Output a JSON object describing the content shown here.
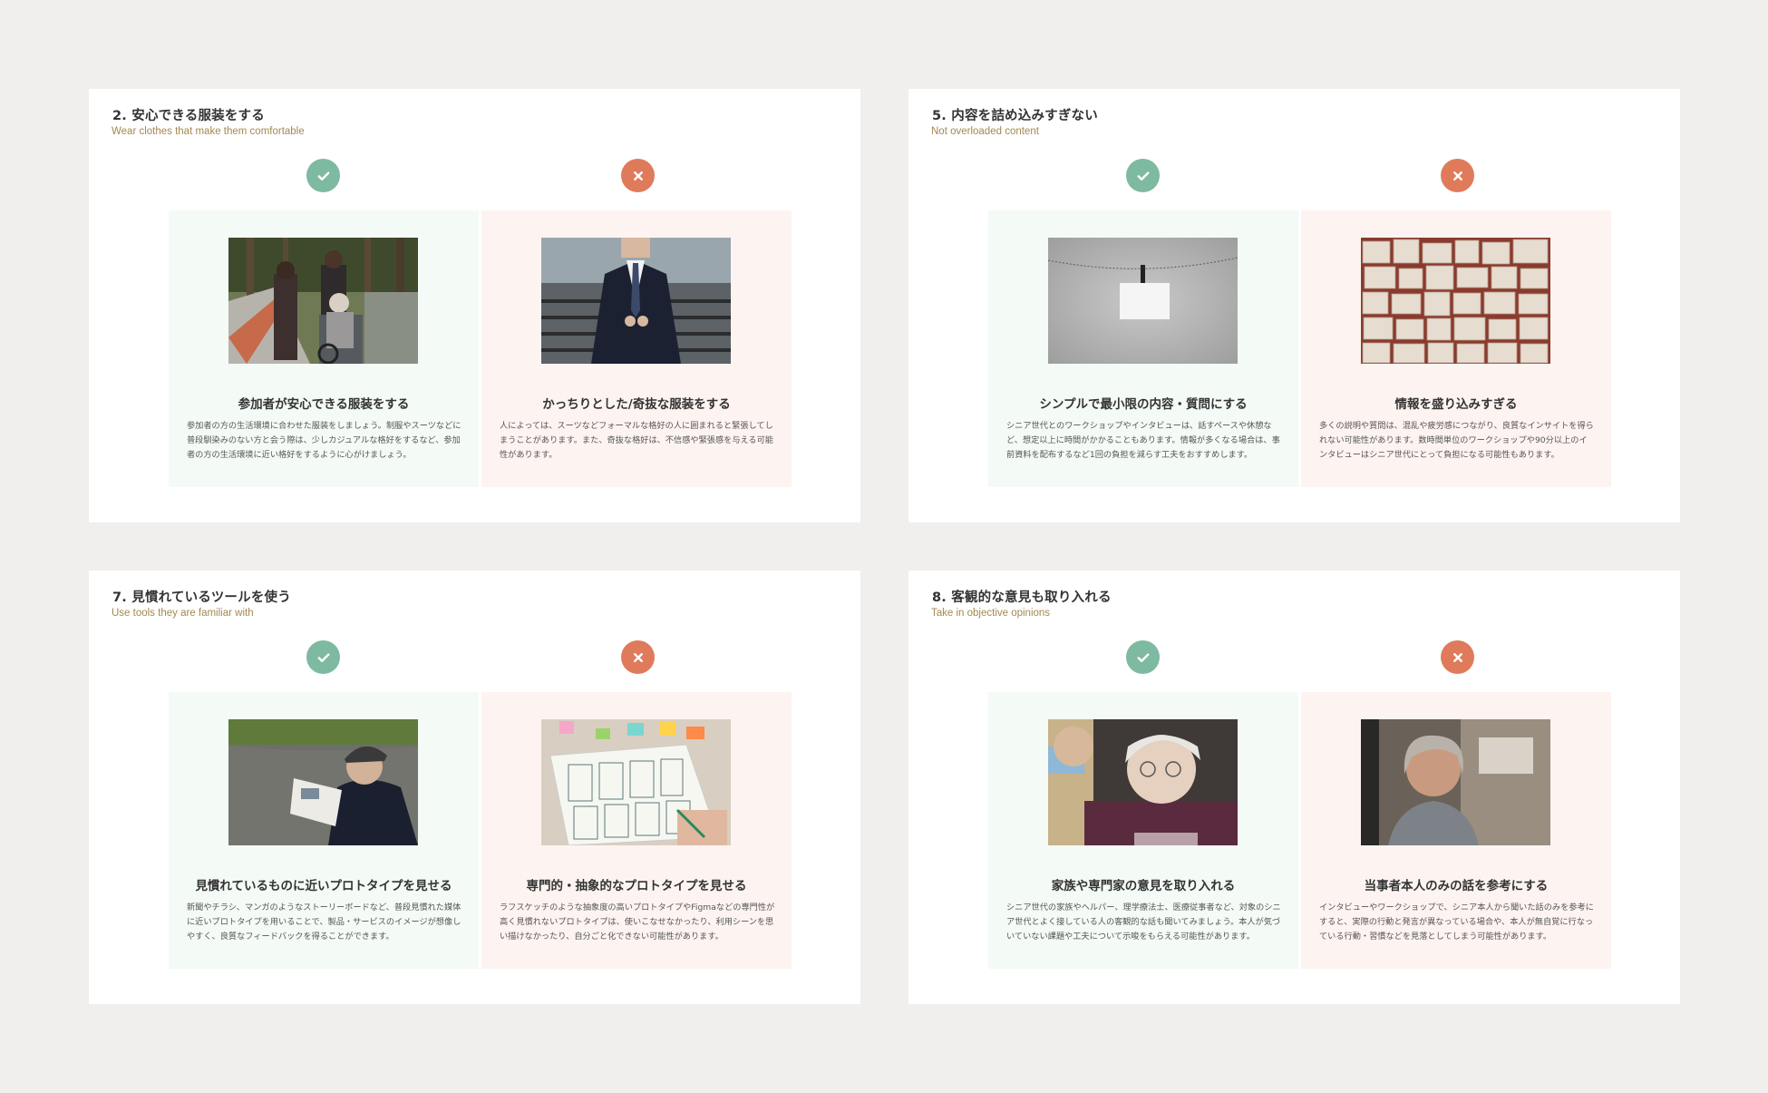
{
  "cards": [
    {
      "title": "2. 安心できる服装をする",
      "subtitle": "Wear clothes that make them comfortable",
      "good": {
        "icon": "check-icon",
        "image": "elderly-woman-in-wheelchair-with-family-photo",
        "heading": "参加者が安心できる服装をする",
        "body": "参加者の方の生活環境に合わせた服装をしましょう。制服やスーツなどに普段馴染みのない方と会う際は、少しカジュアルな格好をするなど、参加者の方の生活環境に近い格好をするように心がけましょう。"
      },
      "bad": {
        "icon": "cross-icon",
        "image": "man-in-formal-suit-photo",
        "heading": "かっちりとした/奇抜な服装をする",
        "body": "人によっては、スーツなどフォーマルな格好の人に囲まれると緊張してしまうことがあります。また、奇抜な格好は、不信感や緊張感を与える可能性があります。"
      }
    },
    {
      "title": "5. 内容を詰め込みすぎない",
      "subtitle": "Not overloaded content",
      "good": {
        "icon": "check-icon",
        "image": "single-card-on-clothesline-photo",
        "heading": "シンプルで最小限の内容・質問にする",
        "body": "シニア世代とのワークショップやインタビューは、話すペースや休憩など、想定以上に時間がかかることもあります。情報が多くなる場合は、事前資料を配布するなど1回の負担を減らす工夫をおすすめします。"
      },
      "bad": {
        "icon": "cross-icon",
        "image": "many-open-books-photo",
        "heading": "情報を盛り込みすぎる",
        "body": "多くの説明や質問は、混乱や疲労感につながり、良質なインサイトを得られない可能性があります。数時間単位のワークショップや90分以上のインタビューはシニア世代にとって負担になる可能性もあります。"
      }
    },
    {
      "title": "7. 見慣れているツールを使う",
      "subtitle": "Use tools  they are familiar with",
      "good": {
        "icon": "check-icon",
        "image": "elderly-man-reading-newspaper-photo",
        "heading": "見慣れているものに近いプロトタイプを見せる",
        "body": "新聞やチラシ、マンガのようなストーリーボードなど、普段見慣れた媒体に近いプロトタイプを用いることで、製品・サービスのイメージが想像しやすく、良質なフィードバックを得ることができます。"
      },
      "bad": {
        "icon": "cross-icon",
        "image": "wireframe-sketches-sticky-notes-photo",
        "heading": "専門的・抽象的なプロトタイプを見せる",
        "body": "ラフスケッチのような抽象度の高いプロトタイプやFigmaなどの専門性が高く見慣れないプロトタイプは、使いこなせなかったり、利用シーンを思い描けなかったり、自分ごと化できない可能性があります。"
      }
    },
    {
      "title": "8. 客観的な意見も取り入れる",
      "subtitle": "Take in objective opinions",
      "good": {
        "icon": "check-icon",
        "image": "elderly-woman-with-caregiver-photo",
        "heading": "家族や専門家の意見を取り入れる",
        "body": "シニア世代の家族やヘルパー、理学療法士、医療従事者など、対象のシニア世代とよく接している人の客観的な話も聞いてみましょう。本人が気づいていない課題や工夫について示唆をもらえる可能性があります。"
      },
      "bad": {
        "icon": "cross-icon",
        "image": "smiling-elderly-woman-portrait-photo",
        "heading": "当事者本人のみの話を参考にする",
        "body": "インタビューやワークショップで、シニア本人から聞いた話のみを参考にすると、実際の行動と発言が異なっている場合や、本人が無自覚に行なっている行動・習慣などを見落としてしまう可能性があります。"
      }
    }
  ],
  "colors": {
    "background": "#f0efed",
    "good": "#7eb9a1",
    "bad": "#df7b5b",
    "good_panel": "#f4faf6",
    "bad_panel": "#fdf4f1",
    "subtitle": "#a3894f"
  }
}
